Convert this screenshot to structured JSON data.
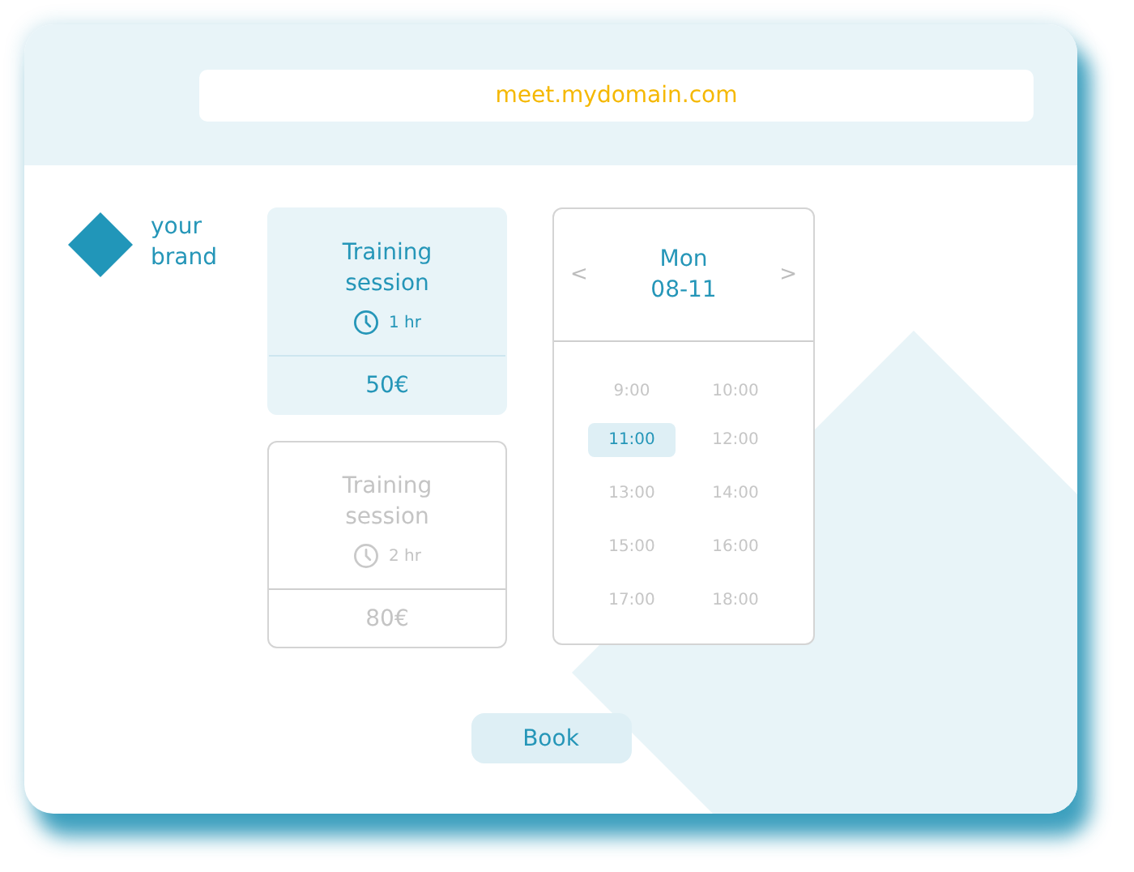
{
  "address_bar": {
    "url": "meet.mydomain.com"
  },
  "brand": {
    "text": "your brand"
  },
  "services": [
    {
      "title": "Training session",
      "duration": "1 hr",
      "price": "50€",
      "selected": true
    },
    {
      "title": "Training session",
      "duration": "2 hr",
      "price": "80€",
      "selected": false
    }
  ],
  "calendar": {
    "prev": "<",
    "day": "Mon",
    "date": "08-11",
    "next": ">",
    "slots": [
      {
        "time": "9:00",
        "selected": false
      },
      {
        "time": "10:00",
        "selected": false
      },
      {
        "time": "11:00",
        "selected": true
      },
      {
        "time": "12:00",
        "selected": false
      },
      {
        "time": "13:00",
        "selected": false
      },
      {
        "time": "14:00",
        "selected": false
      },
      {
        "time": "15:00",
        "selected": false
      },
      {
        "time": "16:00",
        "selected": false
      },
      {
        "time": "17:00",
        "selected": false
      },
      {
        "time": "18:00",
        "selected": false
      }
    ]
  },
  "book_button": {
    "label": "Book"
  }
}
